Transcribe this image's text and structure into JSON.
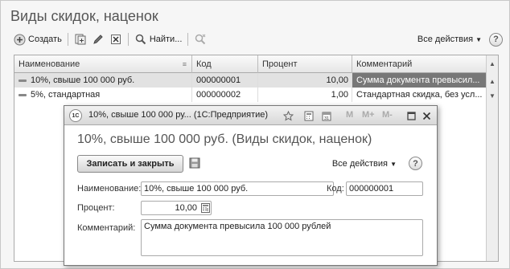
{
  "main": {
    "title": "Виды скидок, наценок",
    "toolbar": {
      "create_label": "Создать",
      "find_label": "Найти...",
      "all_actions_label": "Все действия",
      "help_label": "?"
    },
    "table": {
      "columns": [
        "Наименование",
        "Код",
        "Процент",
        "Комментарий"
      ],
      "rows": [
        {
          "name": "10%, свыше 100 000 руб.",
          "code": "000000001",
          "percent": "10,00",
          "comment": "Сумма документа превысил..."
        },
        {
          "name": "5%, стандартная",
          "code": "000000002",
          "percent": "1,00",
          "comment": "Стандартная скидка, без усл..."
        }
      ]
    }
  },
  "dialog": {
    "title": "10%, свыше 100 000 ру... (1С:Предприятие)",
    "logo_text": "1С",
    "heading": "10%, свыше 100 000 руб. (Виды скидок, наценок)",
    "save_close_label": "Записать и закрыть",
    "all_actions_label": "Все действия",
    "help_label": "?",
    "mem_buttons": [
      "M",
      "M+",
      "M-"
    ],
    "fields": {
      "name_label": "Наименование:",
      "name_value": "10%, свыше 100 000 руб.",
      "code_label": "Код:",
      "code_value": "000000001",
      "percent_label": "Процент:",
      "percent_value": "10,00",
      "comment_label": "Комментарий:",
      "comment_value": "Сумма документа превысила 100 000 рублей"
    }
  }
}
